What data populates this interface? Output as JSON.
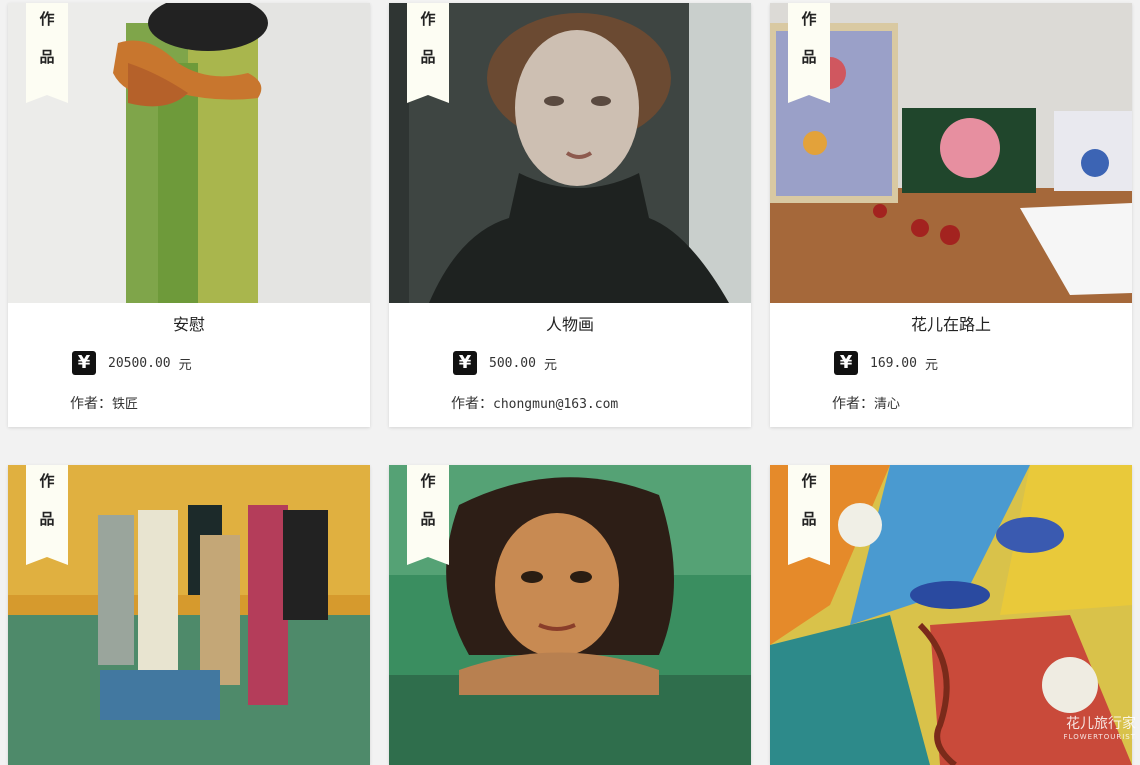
{
  "ribbon": {
    "line1": "作",
    "line2": "品"
  },
  "currency_symbol": "¥",
  "author_label": "作者：",
  "items": [
    {
      "title": "安慰",
      "price": "20500.00",
      "unit": "元",
      "author": "铁匠"
    },
    {
      "title": "人物画",
      "price": "500.00",
      "unit": "元",
      "author": "chongmun@163.com"
    },
    {
      "title": "花儿在路上",
      "price": "169.00",
      "unit": "元",
      "author": "清心"
    },
    {
      "title": "",
      "price": "",
      "unit": "",
      "author": ""
    },
    {
      "title": "",
      "price": "",
      "unit": "",
      "author": ""
    },
    {
      "title": "",
      "price": "",
      "unit": "",
      "author": ""
    }
  ],
  "watermark": {
    "brand_cn": "花儿旅行家",
    "brand_en": "FLOWERTOURIST"
  }
}
